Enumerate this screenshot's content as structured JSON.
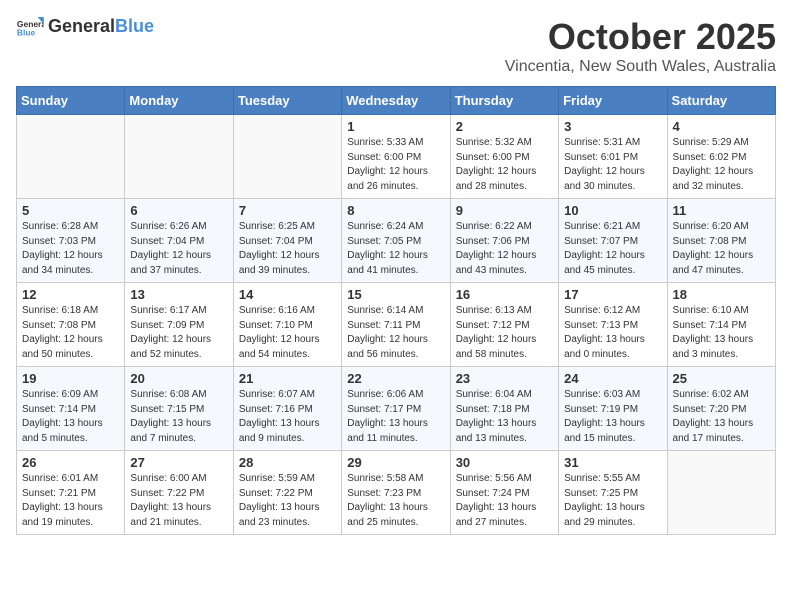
{
  "header": {
    "logo_general": "General",
    "logo_blue": "Blue",
    "month": "October 2025",
    "location": "Vincentia, New South Wales, Australia"
  },
  "weekdays": [
    "Sunday",
    "Monday",
    "Tuesday",
    "Wednesday",
    "Thursday",
    "Friday",
    "Saturday"
  ],
  "weeks": [
    [
      {
        "day": "",
        "info": ""
      },
      {
        "day": "",
        "info": ""
      },
      {
        "day": "",
        "info": ""
      },
      {
        "day": "1",
        "info": "Sunrise: 5:33 AM\nSunset: 6:00 PM\nDaylight: 12 hours\nand 26 minutes."
      },
      {
        "day": "2",
        "info": "Sunrise: 5:32 AM\nSunset: 6:00 PM\nDaylight: 12 hours\nand 28 minutes."
      },
      {
        "day": "3",
        "info": "Sunrise: 5:31 AM\nSunset: 6:01 PM\nDaylight: 12 hours\nand 30 minutes."
      },
      {
        "day": "4",
        "info": "Sunrise: 5:29 AM\nSunset: 6:02 PM\nDaylight: 12 hours\nand 32 minutes."
      }
    ],
    [
      {
        "day": "5",
        "info": "Sunrise: 6:28 AM\nSunset: 7:03 PM\nDaylight: 12 hours\nand 34 minutes."
      },
      {
        "day": "6",
        "info": "Sunrise: 6:26 AM\nSunset: 7:04 PM\nDaylight: 12 hours\nand 37 minutes."
      },
      {
        "day": "7",
        "info": "Sunrise: 6:25 AM\nSunset: 7:04 PM\nDaylight: 12 hours\nand 39 minutes."
      },
      {
        "day": "8",
        "info": "Sunrise: 6:24 AM\nSunset: 7:05 PM\nDaylight: 12 hours\nand 41 minutes."
      },
      {
        "day": "9",
        "info": "Sunrise: 6:22 AM\nSunset: 7:06 PM\nDaylight: 12 hours\nand 43 minutes."
      },
      {
        "day": "10",
        "info": "Sunrise: 6:21 AM\nSunset: 7:07 PM\nDaylight: 12 hours\nand 45 minutes."
      },
      {
        "day": "11",
        "info": "Sunrise: 6:20 AM\nSunset: 7:08 PM\nDaylight: 12 hours\nand 47 minutes."
      }
    ],
    [
      {
        "day": "12",
        "info": "Sunrise: 6:18 AM\nSunset: 7:08 PM\nDaylight: 12 hours\nand 50 minutes."
      },
      {
        "day": "13",
        "info": "Sunrise: 6:17 AM\nSunset: 7:09 PM\nDaylight: 12 hours\nand 52 minutes."
      },
      {
        "day": "14",
        "info": "Sunrise: 6:16 AM\nSunset: 7:10 PM\nDaylight: 12 hours\nand 54 minutes."
      },
      {
        "day": "15",
        "info": "Sunrise: 6:14 AM\nSunset: 7:11 PM\nDaylight: 12 hours\nand 56 minutes."
      },
      {
        "day": "16",
        "info": "Sunrise: 6:13 AM\nSunset: 7:12 PM\nDaylight: 12 hours\nand 58 minutes."
      },
      {
        "day": "17",
        "info": "Sunrise: 6:12 AM\nSunset: 7:13 PM\nDaylight: 13 hours\nand 0 minutes."
      },
      {
        "day": "18",
        "info": "Sunrise: 6:10 AM\nSunset: 7:14 PM\nDaylight: 13 hours\nand 3 minutes."
      }
    ],
    [
      {
        "day": "19",
        "info": "Sunrise: 6:09 AM\nSunset: 7:14 PM\nDaylight: 13 hours\nand 5 minutes."
      },
      {
        "day": "20",
        "info": "Sunrise: 6:08 AM\nSunset: 7:15 PM\nDaylight: 13 hours\nand 7 minutes."
      },
      {
        "day": "21",
        "info": "Sunrise: 6:07 AM\nSunset: 7:16 PM\nDaylight: 13 hours\nand 9 minutes."
      },
      {
        "day": "22",
        "info": "Sunrise: 6:06 AM\nSunset: 7:17 PM\nDaylight: 13 hours\nand 11 minutes."
      },
      {
        "day": "23",
        "info": "Sunrise: 6:04 AM\nSunset: 7:18 PM\nDaylight: 13 hours\nand 13 minutes."
      },
      {
        "day": "24",
        "info": "Sunrise: 6:03 AM\nSunset: 7:19 PM\nDaylight: 13 hours\nand 15 minutes."
      },
      {
        "day": "25",
        "info": "Sunrise: 6:02 AM\nSunset: 7:20 PM\nDaylight: 13 hours\nand 17 minutes."
      }
    ],
    [
      {
        "day": "26",
        "info": "Sunrise: 6:01 AM\nSunset: 7:21 PM\nDaylight: 13 hours\nand 19 minutes."
      },
      {
        "day": "27",
        "info": "Sunrise: 6:00 AM\nSunset: 7:22 PM\nDaylight: 13 hours\nand 21 minutes."
      },
      {
        "day": "28",
        "info": "Sunrise: 5:59 AM\nSunset: 7:22 PM\nDaylight: 13 hours\nand 23 minutes."
      },
      {
        "day": "29",
        "info": "Sunrise: 5:58 AM\nSunset: 7:23 PM\nDaylight: 13 hours\nand 25 minutes."
      },
      {
        "day": "30",
        "info": "Sunrise: 5:56 AM\nSunset: 7:24 PM\nDaylight: 13 hours\nand 27 minutes."
      },
      {
        "day": "31",
        "info": "Sunrise: 5:55 AM\nSunset: 7:25 PM\nDaylight: 13 hours\nand 29 minutes."
      },
      {
        "day": "",
        "info": ""
      }
    ]
  ]
}
